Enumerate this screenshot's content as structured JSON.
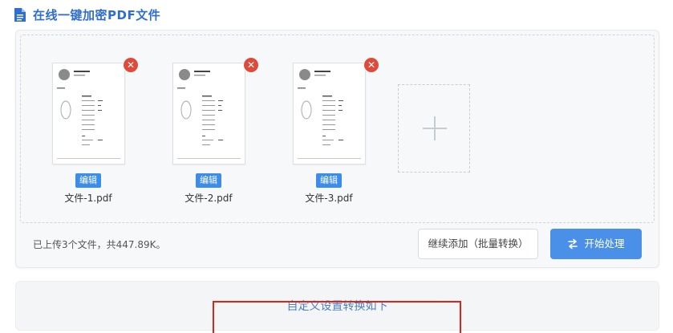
{
  "header": {
    "title": "在线一键加密PDF文件",
    "icon": "document-icon",
    "color": "#2f6ed0"
  },
  "files": [
    {
      "name": "文件-1.pdf",
      "edit_label": "编辑",
      "remove_icon": "close-icon"
    },
    {
      "name": "文件-2.pdf",
      "edit_label": "编辑",
      "remove_icon": "close-icon"
    },
    {
      "name": "文件-3.pdf",
      "edit_label": "编辑",
      "remove_icon": "close-icon"
    }
  ],
  "add_tile": {
    "icon": "plus-icon"
  },
  "footer": {
    "status": "已上传3个文件，共447.89K。",
    "continue_label": "继续添加（批量转换）",
    "start_label": "开始处理",
    "start_icon": "swap-icon",
    "accent": "#4a90e8"
  },
  "settings": {
    "title": "自定义设置转换如下"
  },
  "highlight_color": "#d8261c"
}
